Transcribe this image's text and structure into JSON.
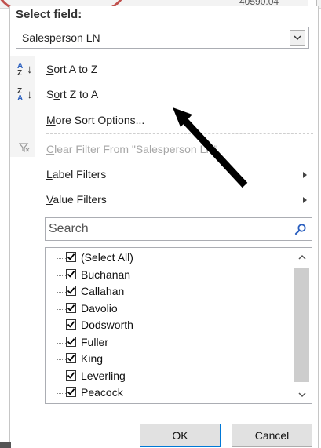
{
  "background": {
    "top_value": "40590.04"
  },
  "panel": {
    "title": "Select field:",
    "field_select": {
      "value": "Salesperson LN"
    },
    "menu": {
      "sort_az": {
        "prefix": "",
        "ul": "S",
        "rest": "ort A to Z"
      },
      "sort_za": {
        "prefix": "S",
        "ul": "o",
        "rest": "rt Z to A"
      },
      "more_sort": {
        "prefix": "",
        "ul": "M",
        "rest": "ore Sort Options..."
      },
      "clear_filter": {
        "prefix": "",
        "ul": "C",
        "rest": "lear Filter From \"Salesperson LN\""
      },
      "label_filters": {
        "prefix": "",
        "ul": "L",
        "rest": "abel Filters"
      },
      "value_filters": {
        "prefix": "",
        "ul": "V",
        "rest": "alue Filters"
      }
    },
    "search": {
      "placeholder": "Search"
    },
    "list_items": [
      {
        "label": "(Select All)",
        "checked": true
      },
      {
        "label": "Buchanan",
        "checked": true
      },
      {
        "label": "Callahan",
        "checked": true
      },
      {
        "label": "Davolio",
        "checked": true
      },
      {
        "label": "Dodsworth",
        "checked": true
      },
      {
        "label": "Fuller",
        "checked": true
      },
      {
        "label": "King",
        "checked": true
      },
      {
        "label": "Leverling",
        "checked": true
      },
      {
        "label": "Peacock",
        "checked": true
      }
    ],
    "buttons": {
      "ok": "OK",
      "cancel": "Cancel"
    }
  },
  "colors": {
    "annotation_ellipse": "#c0504d",
    "annotation_arrow": "#000000",
    "checkmark": "#000000",
    "sort_letters": "#2a5fbf",
    "ok_border": "#0078d7"
  },
  "icons": {
    "sort_az": "sort-a-to-z-icon",
    "sort_za": "sort-z-to-a-icon",
    "clear_filter": "clear-filter-icon",
    "search": "search-icon",
    "dropdown": "chevron-down-icon",
    "submenu": "chevron-right-icon"
  }
}
